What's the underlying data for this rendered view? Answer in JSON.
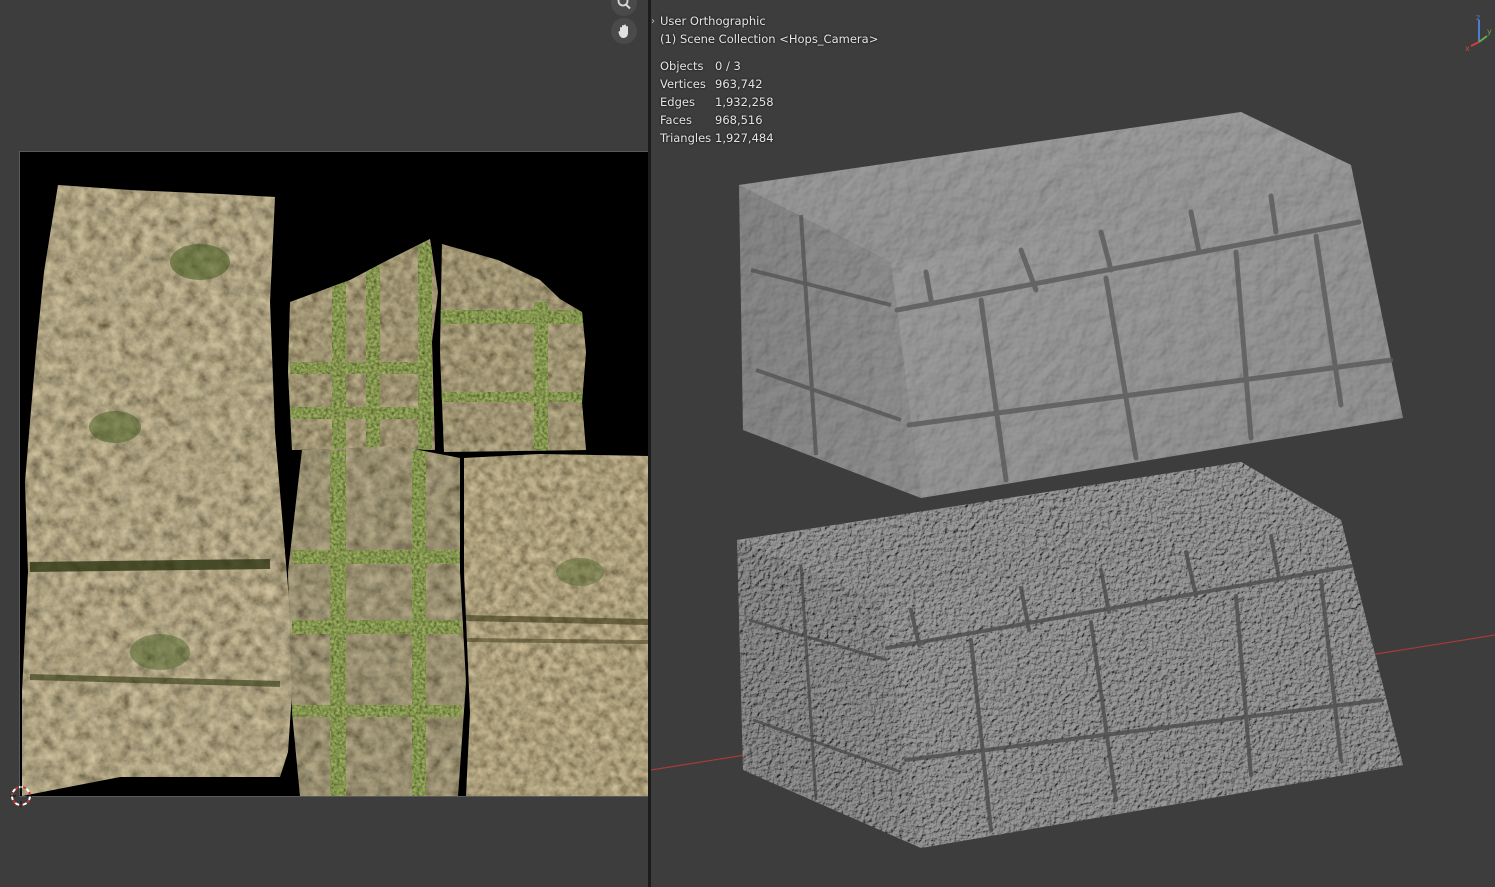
{
  "viewport": {
    "view_name": "User Orthographic",
    "collection": "(1) Scene Collection <Hops_Camera>",
    "stats": [
      {
        "label": "Objects",
        "value": "0 / 3"
      },
      {
        "label": "Vertices",
        "value": "963,742"
      },
      {
        "label": "Edges",
        "value": "1,932,258"
      },
      {
        "label": "Faces",
        "value": "968,516"
      },
      {
        "label": "Triangles",
        "value": "1,927,484"
      }
    ],
    "axis_gizmo": {
      "z": "z",
      "y": "y",
      "x": "x"
    }
  },
  "uv_editor": {
    "icons": [
      "zoom-icon",
      "hand-pan-icon",
      "2d-cursor-icon"
    ]
  },
  "colors": {
    "background": "#3d3d3d",
    "divider": "#1c1c1c",
    "x_axis_line": "#a83a3a",
    "stone_mesh": "#8c8c8c",
    "texture_moss": "#4a5a22",
    "texture_sand": "#a08660"
  }
}
